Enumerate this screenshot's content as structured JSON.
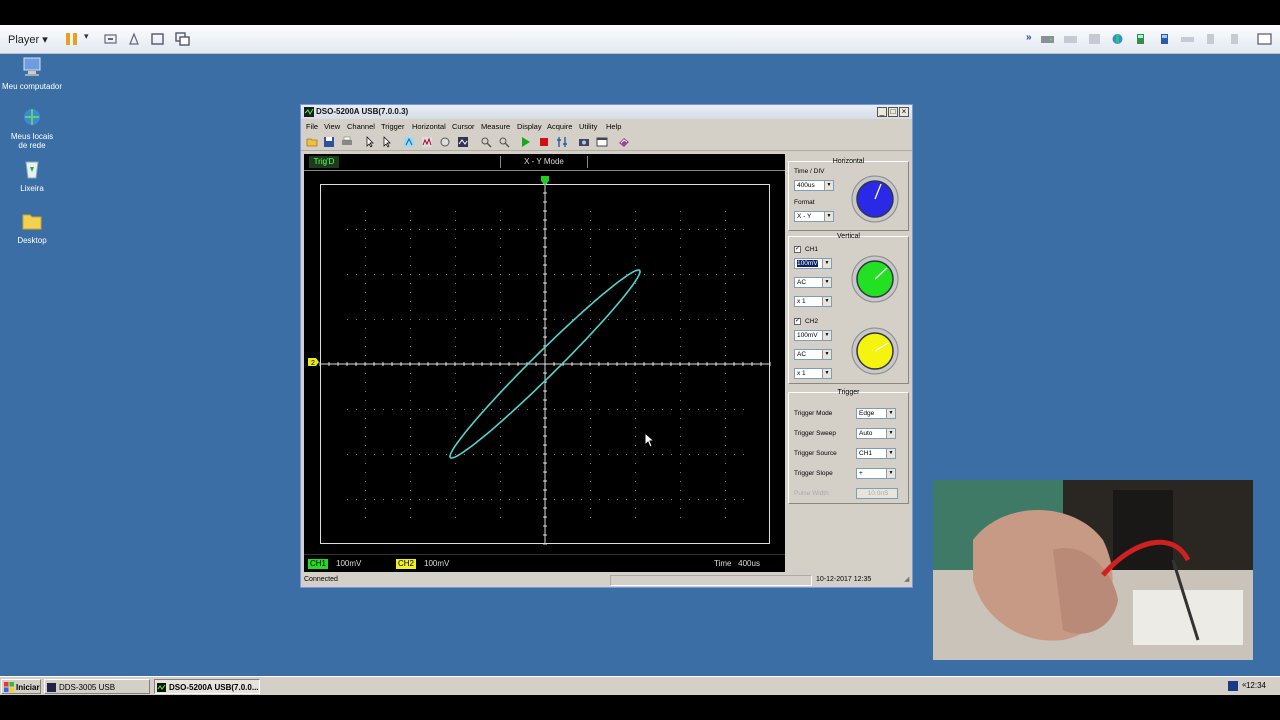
{
  "player": {
    "menu_label": "Player"
  },
  "desktop_icons": [
    {
      "label": "Meu computador",
      "icon": "computer-icon"
    },
    {
      "label": "Meus locais de rede",
      "icon": "network-places-icon"
    },
    {
      "label": "Lixeira",
      "icon": "recycle-bin-icon"
    },
    {
      "label": "Desktop",
      "icon": "folder-icon"
    }
  ],
  "window": {
    "title": "DSO-5200A USB(7.0.0.3)",
    "menu": [
      "File",
      "View",
      "Channel",
      "Trigger",
      "Horizontal",
      "Cursor",
      "Measure",
      "Display",
      "Acquire",
      "Utility",
      "Help"
    ]
  },
  "scope": {
    "trig_status": "Trig'D",
    "mode": "X - Y Mode",
    "ch1_tag": "CH1",
    "ch1_value": "100mV",
    "ch2_tag": "CH2",
    "ch2_value": "100mV",
    "time_label": "Time",
    "time_value": "400us",
    "ch2_marker": "2",
    "trace_color": "#4fd6d0"
  },
  "panel": {
    "horizontal": {
      "title": "Horizontal",
      "time_div_label": "Time / DIV",
      "time_div_value": "400us",
      "format_label": "Format",
      "format_value": "X - Y",
      "knob_color": "#2a2ae6"
    },
    "vertical": {
      "title": "Vertical",
      "ch1_label": "CH1",
      "ch1_volts": "100mV",
      "ch1_coupling": "AC",
      "ch1_probe": "x 1",
      "ch1_knob_color": "#22e022",
      "ch2_label": "CH2",
      "ch2_volts": "100mV",
      "ch2_coupling": "AC",
      "ch2_probe": "x 1",
      "ch2_knob_color": "#f4f410"
    },
    "trigger": {
      "title": "Trigger",
      "mode_label": "Trigger Mode",
      "mode_value": "Edge",
      "sweep_label": "Trigger Sweep",
      "sweep_value": "Auto",
      "source_label": "Trigger Source",
      "source_value": "CH1",
      "slope_label": "Trigger Slope",
      "slope_value": "+",
      "pulse_label": "Pulse Width",
      "pulse_value": "10.0nS"
    }
  },
  "status": {
    "connection": "Connected",
    "datetime": "10-12-2017  12:35"
  },
  "taskbar": {
    "start": "Iniciar",
    "tasks": [
      "DDS-3005 USB",
      "DSO-5200A USB(7.0.0..."
    ],
    "clock": "12:34"
  }
}
